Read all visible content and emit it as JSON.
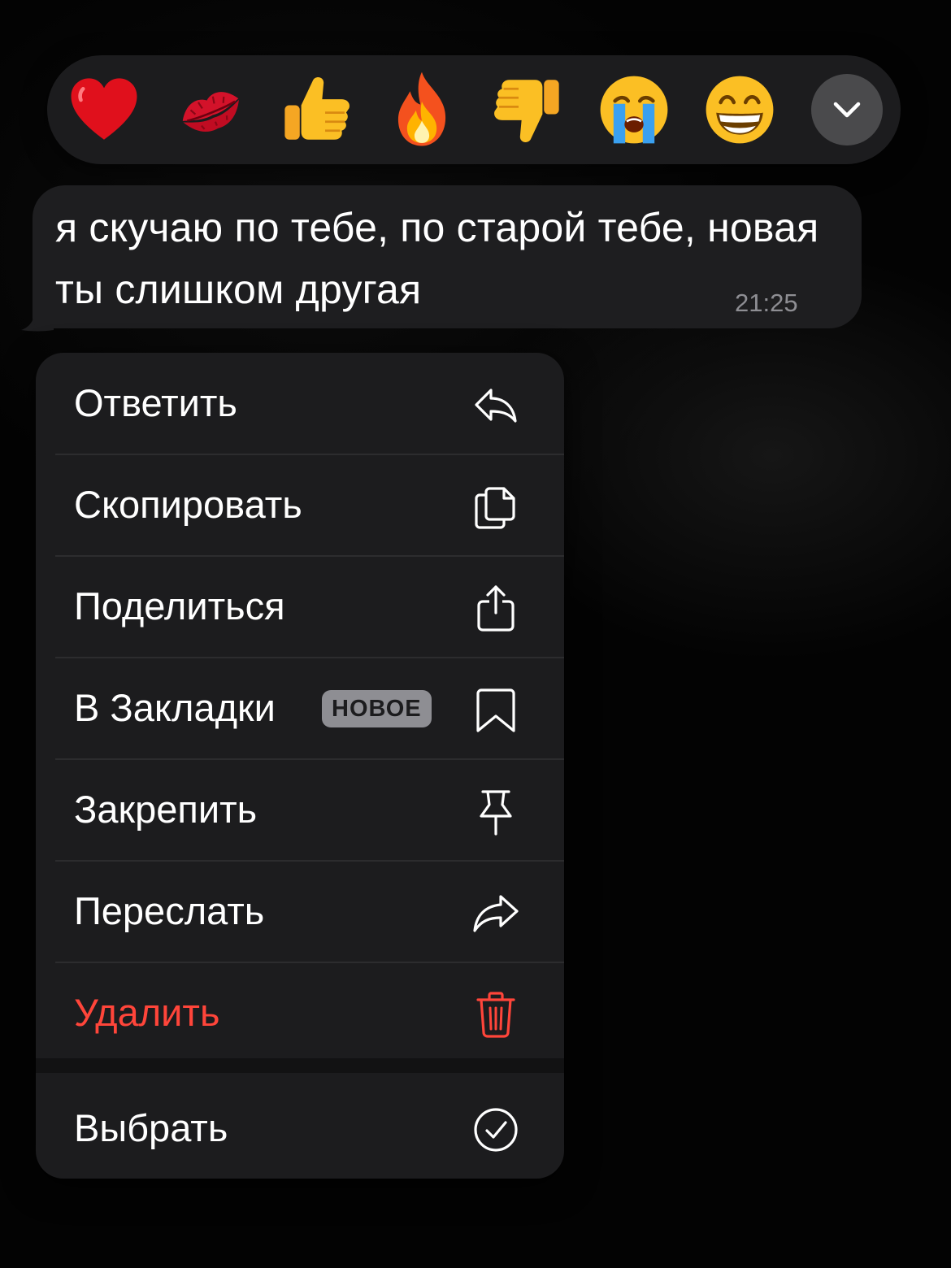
{
  "reactions": [
    {
      "emoji": "❤️",
      "name": "heart"
    },
    {
      "emoji": "💋",
      "name": "kiss-mark"
    },
    {
      "emoji": "👍",
      "name": "thumbs-up"
    },
    {
      "emoji": "🔥",
      "name": "fire"
    },
    {
      "emoji": "👎",
      "name": "thumbs-down"
    },
    {
      "emoji": "😭",
      "name": "loudly-crying"
    },
    {
      "emoji": "😁",
      "name": "beaming-face"
    }
  ],
  "expand_icon": "chevron-down-icon",
  "message": {
    "text": "я скучаю по тебе, по старой тебе, новая ты слишком другая",
    "time": "21:25"
  },
  "menu": {
    "reply": "Ответить",
    "copy": "Скопировать",
    "share": "Поделиться",
    "bookmark": "В Закладки",
    "bookmark_badge": "НОВОЕ",
    "pin": "Закрепить",
    "forward": "Переслать",
    "delete": "Удалить",
    "select": "Выбрать"
  },
  "colors": {
    "danger": "#ff453a",
    "menu_bg": "#1c1c1e",
    "text": "#ffffff",
    "secondary": "#8e8e93"
  }
}
